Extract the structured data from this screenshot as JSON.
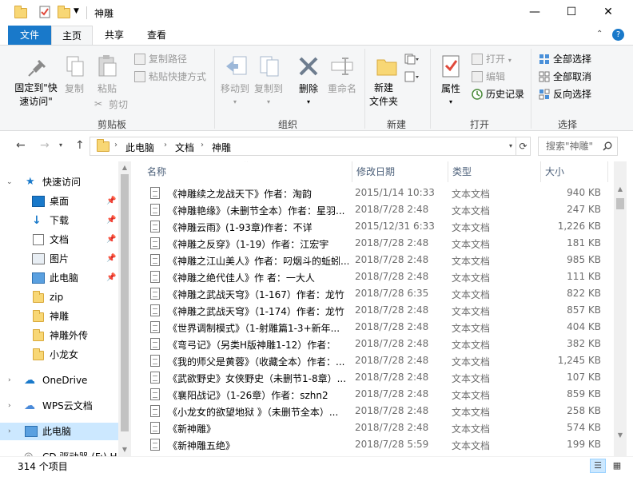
{
  "window": {
    "title": "神雕",
    "controls": {
      "minimize": "—",
      "maximize": "☐",
      "close": "✕"
    }
  },
  "ribbon_tabs": [
    "文件",
    "主页",
    "共享",
    "查看"
  ],
  "ribbon": {
    "clipboard": {
      "label": "剪贴板",
      "pin": "固定到\"快速访问\"",
      "copy": "复制",
      "paste": "粘贴",
      "cut": "剪切",
      "copy_path": "复制路径",
      "paste_shortcut": "粘贴快捷方式"
    },
    "organize": {
      "label": "组织",
      "move_to": "移动到",
      "copy_to": "复制到",
      "delete": "删除",
      "rename": "重命名"
    },
    "new": {
      "label": "新建",
      "new_folder": "新建\n文件夹"
    },
    "open": {
      "label": "打开",
      "properties": "属性",
      "open": "打开",
      "edit": "编辑",
      "history": "历史记录"
    },
    "select": {
      "label": "选择",
      "select_all": "全部选择",
      "select_none": "全部取消",
      "invert": "反向选择"
    }
  },
  "address": {
    "breadcrumbs": [
      "此电脑",
      "文档",
      "神雕"
    ],
    "search_placeholder": "搜索\"神雕\""
  },
  "nav": {
    "quick_access": "快速访问",
    "items": [
      {
        "label": "桌面",
        "pinned": true
      },
      {
        "label": "下载",
        "pinned": true
      },
      {
        "label": "文档",
        "pinned": true
      },
      {
        "label": "图片",
        "pinned": true
      },
      {
        "label": "此电脑",
        "pinned": true
      },
      {
        "label": "zip",
        "pinned": false
      },
      {
        "label": "神雕",
        "pinned": false
      },
      {
        "label": "神雕外传",
        "pinned": false
      },
      {
        "label": "小龙女",
        "pinned": false
      }
    ],
    "onedrive": "OneDrive",
    "wps": "WPS云文档",
    "this_pc": "此电脑",
    "cd_drive": "CD 驱动器 (F:) H"
  },
  "columns": {
    "name": "名称",
    "date": "修改日期",
    "type": "类型",
    "size": "大小"
  },
  "files": [
    {
      "name": "《神雕续之龙战天下》作者：淘韵",
      "date": "2015/1/14 10:33",
      "type": "文本文档",
      "size": "940 KB"
    },
    {
      "name": "《神雕艳缘》（未删节全本）作者：星羽...",
      "date": "2018/7/28 2:48",
      "type": "文本文档",
      "size": "247 KB"
    },
    {
      "name": "《神雕云雨》(1-93章)作者：不详",
      "date": "2015/12/31 6:33",
      "type": "文本文档",
      "size": "1,226 KB"
    },
    {
      "name": "《神雕之反穿》（1-19）作者：江宏宇",
      "date": "2018/7/28 2:48",
      "type": "文本文档",
      "size": "181 KB"
    },
    {
      "name": "《神雕之江山美人》作者：叼烟斗的蚯蚓...",
      "date": "2018/7/28 2:48",
      "type": "文本文档",
      "size": "985 KB"
    },
    {
      "name": "《神雕之绝代佳人》作 者：一大人",
      "date": "2018/7/28 2:48",
      "type": "文本文档",
      "size": "111 KB"
    },
    {
      "name": "《神雕之武战天穹》（1-167）作者：龙竹",
      "date": "2018/7/28 6:35",
      "type": "文本文档",
      "size": "822 KB"
    },
    {
      "name": "《神雕之武战天穹》（1-174）作者：龙竹",
      "date": "2018/7/28 2:48",
      "type": "文本文档",
      "size": "857 KB"
    },
    {
      "name": "《世界调制模式》（1-射雕篇1-3+新年...",
      "date": "2018/7/28 2:48",
      "type": "文本文档",
      "size": "404 KB"
    },
    {
      "name": "《弯弓记》（另类H版神雕1-12）作者：",
      "date": "2018/7/28 2:48",
      "type": "文本文档",
      "size": "382 KB"
    },
    {
      "name": "《我的师父是黄蓉》（收藏全本）作者：...",
      "date": "2018/7/28 2:48",
      "type": "文本文档",
      "size": "1,245 KB"
    },
    {
      "name": "《武欲野史》女侠野史（未删节1-8章）...",
      "date": "2018/7/28 2:48",
      "type": "文本文档",
      "size": "107 KB"
    },
    {
      "name": "《襄阳战记》（1-26章）作者：szhn2",
      "date": "2018/7/28 2:48",
      "type": "文本文档",
      "size": "859 KB"
    },
    {
      "name": "《小龙女的欲望地狱 》（未删节全本）...",
      "date": "2018/7/28 2:48",
      "type": "文本文档",
      "size": "258 KB"
    },
    {
      "name": "《新神雕》",
      "date": "2018/7/28 2:48",
      "type": "文本文档",
      "size": "574 KB"
    },
    {
      "name": "《新神雕五绝》",
      "date": "2018/7/28 5:59",
      "type": "文本文档",
      "size": "199 KB"
    }
  ],
  "status": {
    "count": "314 个项目"
  }
}
